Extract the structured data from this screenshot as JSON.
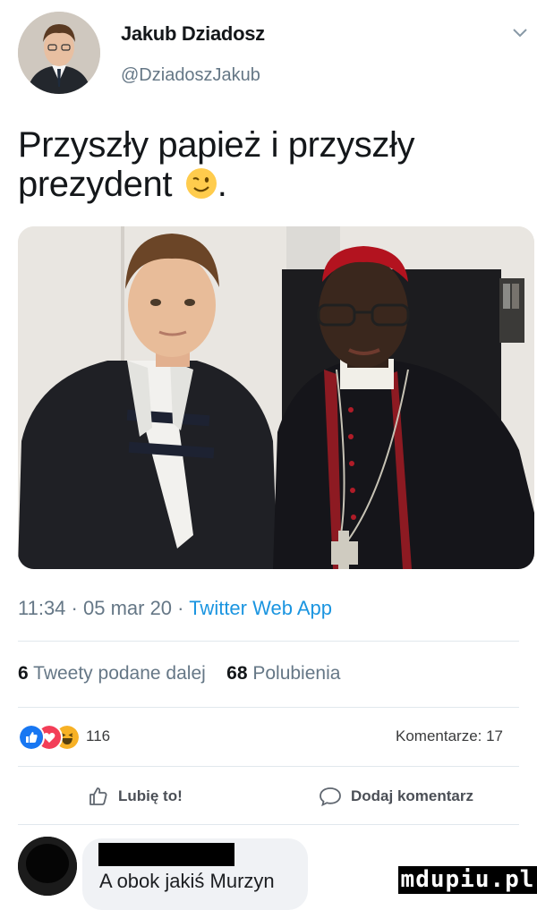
{
  "header": {
    "name": "Jakub Dziadosz",
    "handle": "@DziadoszJakub"
  },
  "tweet": {
    "text": "Przyszły papież i przyszły prezydent",
    "trailing": "."
  },
  "meta": {
    "time": "11:34",
    "date": "05 mar 20",
    "app": "Twitter Web App",
    "sep": " · "
  },
  "stats": {
    "retweets_count": "6",
    "retweets_label": "Tweety podane dalej",
    "likes_count": "68",
    "likes_label": "Polubienia"
  },
  "facebook": {
    "reactions": [
      "like-icon",
      "love-icon",
      "haha-icon"
    ],
    "reactions_count": "116",
    "comments": "Komentarze: 17",
    "like_label": "Lubię to!",
    "comment_label": "Dodaj komentarz",
    "comment_text": "A obok jakiś Murzyn"
  },
  "watermark": "mdupiu.pl",
  "colors": {
    "accent": "#1b95e0",
    "secondary_text": "#657786",
    "fb_blue": "#1877f2",
    "fb_red": "#f33e58",
    "fb_yellow": "#f7b125"
  }
}
